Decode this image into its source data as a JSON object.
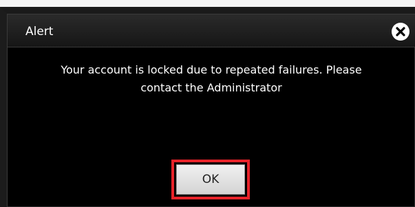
{
  "dialog": {
    "title": "Alert",
    "message_line1": "Your account is locked due to repeated failures. Please",
    "message_line2": "contact the Administrator",
    "ok_label": "OK",
    "close_icon": "close-circle-icon"
  },
  "colors": {
    "dialog_background": "#000000",
    "text": "#ffffff",
    "highlight_border": "#e8232a",
    "button_face": "#e0e0e0"
  }
}
